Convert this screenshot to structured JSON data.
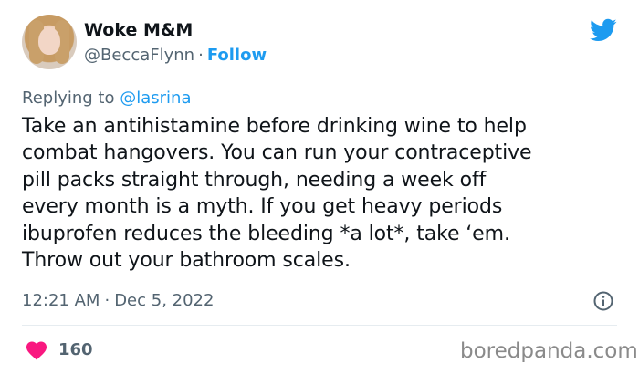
{
  "author": {
    "display_name": "Woke M&M",
    "handle": "@BeccaFlynn",
    "separator": "·",
    "follow_label": "Follow"
  },
  "reply": {
    "prefix": "Replying to",
    "mention": "@lasrina"
  },
  "tweet": {
    "text": "Take an antihistamine before drinking wine to help\ncombat hangovers. You can run your contraceptive\npill packs straight through, needing a week off\nevery month is a myth. If you get heavy periods\nibuprofen reduces the bleeding *a lot*, take ‘em.\nThrow out your bathroom scales.",
    "time": "12:21 AM",
    "separator": "·",
    "date": "Dec 5, 2022"
  },
  "engagement": {
    "likes": "160"
  },
  "watermark": "boredpanda.com",
  "icons": {
    "brand": "twitter-bird-icon",
    "info": "info-icon",
    "like": "heart-icon"
  },
  "colors": {
    "accent": "#1d9bf0",
    "like": "#f91880",
    "secondary_text": "#536471"
  }
}
